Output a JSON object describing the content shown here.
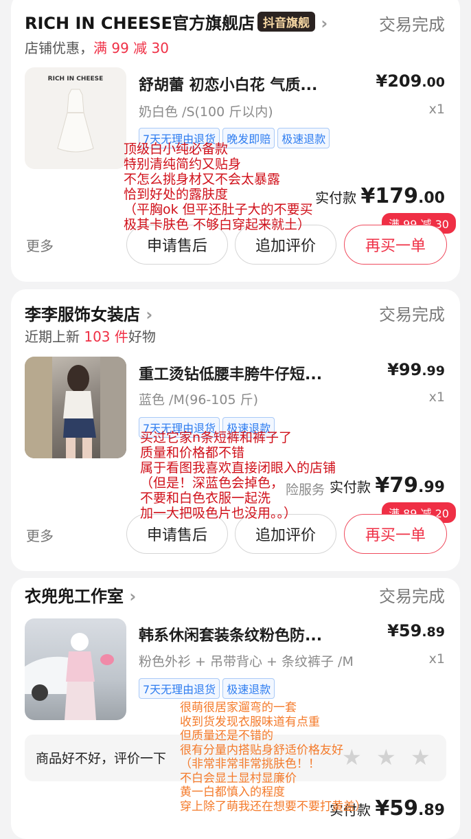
{
  "orders": [
    {
      "shop": {
        "name": "RICH IN CHEESE官方旗舰店",
        "badge": "抖音旗舰",
        "status": "交易完成"
      },
      "promo": {
        "prefix": "店铺优惠，",
        "highlight": "满 99 减 30"
      },
      "product": {
        "thumb_logo": "RICH IN CHEESE",
        "title": "舒胡蕾 初恋小白花 气质...",
        "price_int": "¥209",
        "price_dec": ".00",
        "variant": "奶白色 /S(100 斤以内)",
        "qty": "x1",
        "tags": [
          "7天无理由退货",
          "晚发即赔",
          "极速退款"
        ]
      },
      "paid": {
        "label": "实付款",
        "int": "¥179",
        "dec": ".00"
      },
      "coupon": "满 99 减 30",
      "actions": {
        "more": "更多",
        "after_sale": "申请售后",
        "add_review": "追加评价",
        "rebuy": "再买一单"
      },
      "note": "顶级白小纯必备款\n特别清纯简约又贴身\n不怎么挑身材又不会太暴露\n恰到好处的露肤度\n（平胸ok 但平还肚子大的不要买\n极其卡肤色 不够白穿起来就土）"
    },
    {
      "shop": {
        "name": "李李服饰女装店",
        "status": "交易完成"
      },
      "promo": {
        "prefix": "近期上新 ",
        "highlight": "103 件",
        "suffix": "好物"
      },
      "product": {
        "title": "重工烫钻低腰丰胯牛仔短...",
        "price_int": "¥99",
        "price_dec": ".99",
        "variant": "蓝色 /M(96-105 斤)",
        "qty": "x1",
        "tags": [
          "7天无理由退货",
          "极速退款"
        ]
      },
      "service_text": "险服务",
      "paid": {
        "label": "实付款",
        "int": "¥79",
        "dec": ".99"
      },
      "coupon": "满 89 减 20",
      "actions": {
        "more": "更多",
        "after_sale": "申请售后",
        "add_review": "追加评价",
        "rebuy": "再买一单"
      },
      "note": "买过它家n条短裤和裤子了\n质量和价格都不错\n属于看图我喜欢直接闭眼入的店铺\n（但是！深蓝色会掉色，\n不要和白色衣服一起洗\n加一大把吸色片也没用。。）"
    },
    {
      "shop": {
        "name": "衣兜兜工作室",
        "status": "交易完成"
      },
      "product": {
        "title": "韩系休闲套装条纹粉色防...",
        "price_int": "¥59",
        "price_dec": ".89",
        "variant": "粉色外衫 + 吊带背心 + 条纹裤子 /M",
        "qty": "x1",
        "tags": [
          "7天无理由退货",
          "极速退款"
        ]
      },
      "review_prompt": "商品好不好，评价一下",
      "paid": {
        "label": "实付款",
        "int": "¥59",
        "dec": ".89"
      },
      "note": "很萌很居家遛弯的一套\n收到货发现衣服味道有点重\n但质量还是不错的\n很有分量内搭贴身舒适价格友好\n（非常非常非常挑肤色！！\n不白会显土显村显廉价\n黄一白都慎入的程度\n穿上除了萌我还在想要不要打黄盖）"
    }
  ],
  "colors": {
    "accent_red": "#ef2f45",
    "tag_blue": "#2f7df0",
    "note_red": "#d0101a",
    "note_orange": "#f47a2a"
  }
}
